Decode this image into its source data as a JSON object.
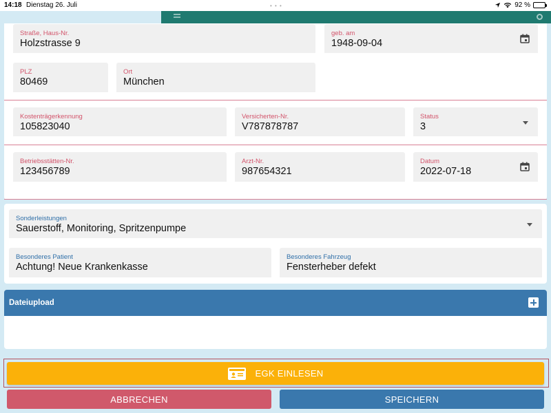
{
  "status_bar": {
    "time": "14:18",
    "date": "Dienstag 26. Juli",
    "battery": "92 %"
  },
  "form": {
    "strasse": {
      "label": "Straße, Haus-Nr.",
      "value": "Holzstrasse 9"
    },
    "geb_am": {
      "label": "geb. am",
      "value": "1948-09-04"
    },
    "plz": {
      "label": "PLZ",
      "value": "80469"
    },
    "ort": {
      "label": "Ort",
      "value": "München"
    },
    "kostentraeger": {
      "label": "Kostenträgerkennung",
      "value": "105823040"
    },
    "versicherten_nr": {
      "label": "Versicherten-Nr.",
      "value": "V787878787"
    },
    "status": {
      "label": "Status",
      "value": "3"
    },
    "betriebsstaetten_nr": {
      "label": "Betriebsstätten-Nr.",
      "value": "123456789"
    },
    "arzt_nr": {
      "label": "Arzt-Nr.",
      "value": "987654321"
    },
    "datum": {
      "label": "Datum",
      "value": "2022-07-18"
    }
  },
  "extras": {
    "sonderleistungen": {
      "label": "Sonderleistungen",
      "value": "Sauerstoff, Monitoring, Spritzenpumpe"
    },
    "besonderes_patient": {
      "label": "Besonderes Patient",
      "value": "Achtung! Neue Krankenkasse"
    },
    "besonderes_fahrzeug": {
      "label": "Besonderes Fahrzeug",
      "value": "Fensterheber defekt"
    }
  },
  "upload": {
    "title": "Dateiupload"
  },
  "buttons": {
    "egk": "EGK EINLESEN",
    "cancel": "ABBRECHEN",
    "save": "SPEICHERN"
  },
  "colors": {
    "background": "#d4eaf4",
    "header_green": "#1f7a70",
    "label_red": "#d2536a",
    "label_blue": "#2f6fa8",
    "upload_blue": "#3a78ad",
    "egk_yellow": "#fbb109",
    "cancel_red": "#d0596b",
    "save_blue": "#3a78ad"
  }
}
